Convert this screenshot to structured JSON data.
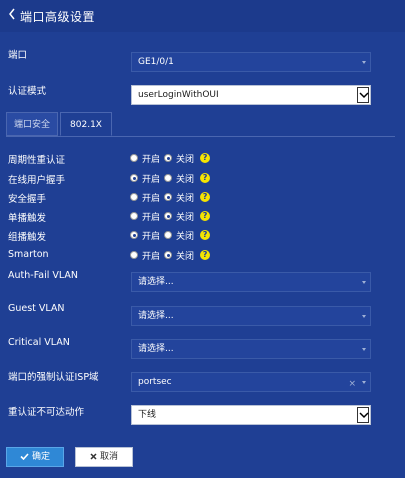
{
  "header": {
    "title": "端口高级设置"
  },
  "form": {
    "port": {
      "label": "端口",
      "value": "GE1/0/1"
    },
    "auth_mode": {
      "label": "认证模式",
      "value": "userLoginWithOUI"
    },
    "tabs": [
      {
        "label": "端口安全"
      },
      {
        "label": "802.1X"
      }
    ],
    "radios": [
      {
        "label": "周期性重认证",
        "on": "开启",
        "off": "关闭",
        "selected": "off"
      },
      {
        "label": "在线用户握手",
        "on": "开启",
        "off": "关闭",
        "selected": "on"
      },
      {
        "label": "安全握手",
        "on": "开启",
        "off": "关闭",
        "selected": "off"
      },
      {
        "label": "单播触发",
        "on": "开启",
        "off": "关闭",
        "selected": "off"
      },
      {
        "label": "组播触发",
        "on": "开启",
        "off": "关闭",
        "selected": "on"
      },
      {
        "label": "Smarton",
        "on": "开启",
        "off": "关闭",
        "selected": "off"
      }
    ],
    "help_glyph": "?",
    "auth_fail_vlan": {
      "label": "Auth-Fail VLAN",
      "placeholder": "请选择..."
    },
    "guest_vlan": {
      "label": "Guest VLAN",
      "placeholder": "请选择..."
    },
    "critical_vlan": {
      "label": "Critical VLAN",
      "placeholder": "请选择..."
    },
    "forced_domain": {
      "label": "端口的强制认证ISP域",
      "value": "portsec",
      "clear": "×"
    },
    "unreachable_action": {
      "label": "重认证不可达动作",
      "value": "下线"
    }
  },
  "buttons": {
    "ok": "确定",
    "cancel": "取消"
  },
  "colors": {
    "background": "#1f3f94",
    "help": "#f5e400",
    "ok_button": "#2f88d6"
  }
}
